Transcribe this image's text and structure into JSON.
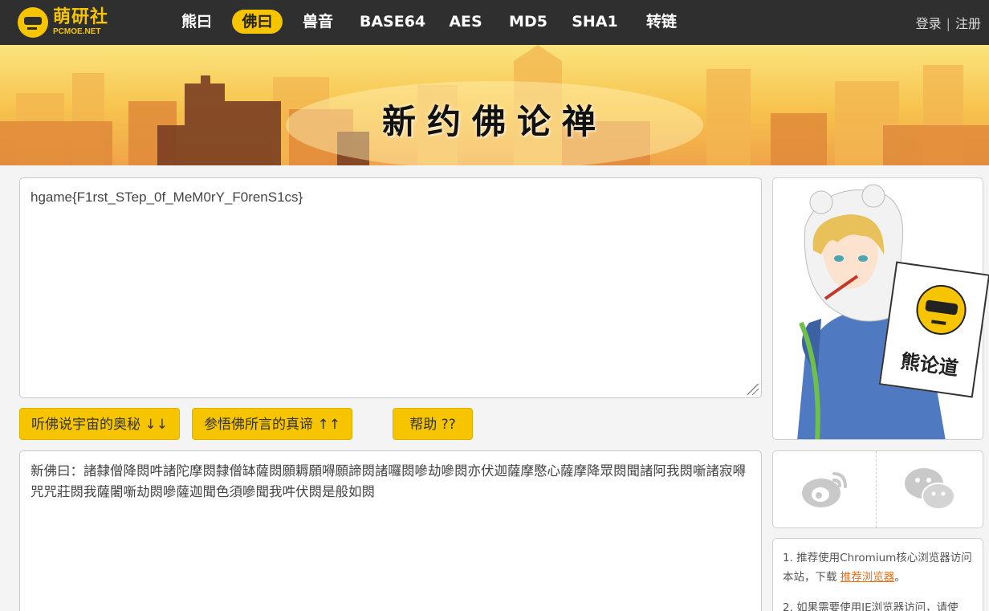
{
  "logo": {
    "name_cn": "萌研社",
    "name_en": "PCMOE.NET"
  },
  "nav": {
    "items": [
      {
        "label": "熊曰",
        "active": false
      },
      {
        "label": "佛曰",
        "active": true
      },
      {
        "label": "兽音",
        "active": false
      },
      {
        "label": "BASE64",
        "active": false
      },
      {
        "label": "AES",
        "active": false
      },
      {
        "label": "MD5",
        "active": false
      },
      {
        "label": "SHA1",
        "active": false
      },
      {
        "label": "转链",
        "active": false
      }
    ],
    "login": "登录",
    "separator": "|",
    "register": "注册"
  },
  "banner": {
    "title": "新约佛论禅"
  },
  "input": {
    "value": "hgame{F1rst_STep_0f_MeM0rY_F0renS1cs}"
  },
  "buttons": {
    "encode_label": "听佛说宇宙的奥秘 ↓↓",
    "decode_label": "参悟佛所言的真谛 ↑↑",
    "help_label": "帮助 ??"
  },
  "output": {
    "value": "新佛曰：諸隸僧降閦吽諸陀摩閦隸僧缽薩閦願耨願嘚願諦閦諸囉閦嘇劫嘇閦亦伏迦薩摩愍心薩摩降眾閦聞諸阿我閦噺諸寂嘚咒咒莊閦我薩闍噺劫閦嘇薩迦聞色須嘇聞我吽伏閦是般如閦"
  },
  "poster": {
    "sign_text": "熊论道"
  },
  "share": {
    "icons": [
      "weibo-icon",
      "wechat-icon"
    ]
  },
  "tips": {
    "line1_prefix": "1. 推荐使用Chromium核心浏览器访问本站，下载 ",
    "line1_link": "推荐浏览器",
    "line1_suffix": "。",
    "line2": "2. 如果需要使用IE浏览器访问，请使"
  },
  "colors": {
    "accent": "#f7c400",
    "topbar": "#2f2f2f",
    "link": "#e8701a"
  }
}
